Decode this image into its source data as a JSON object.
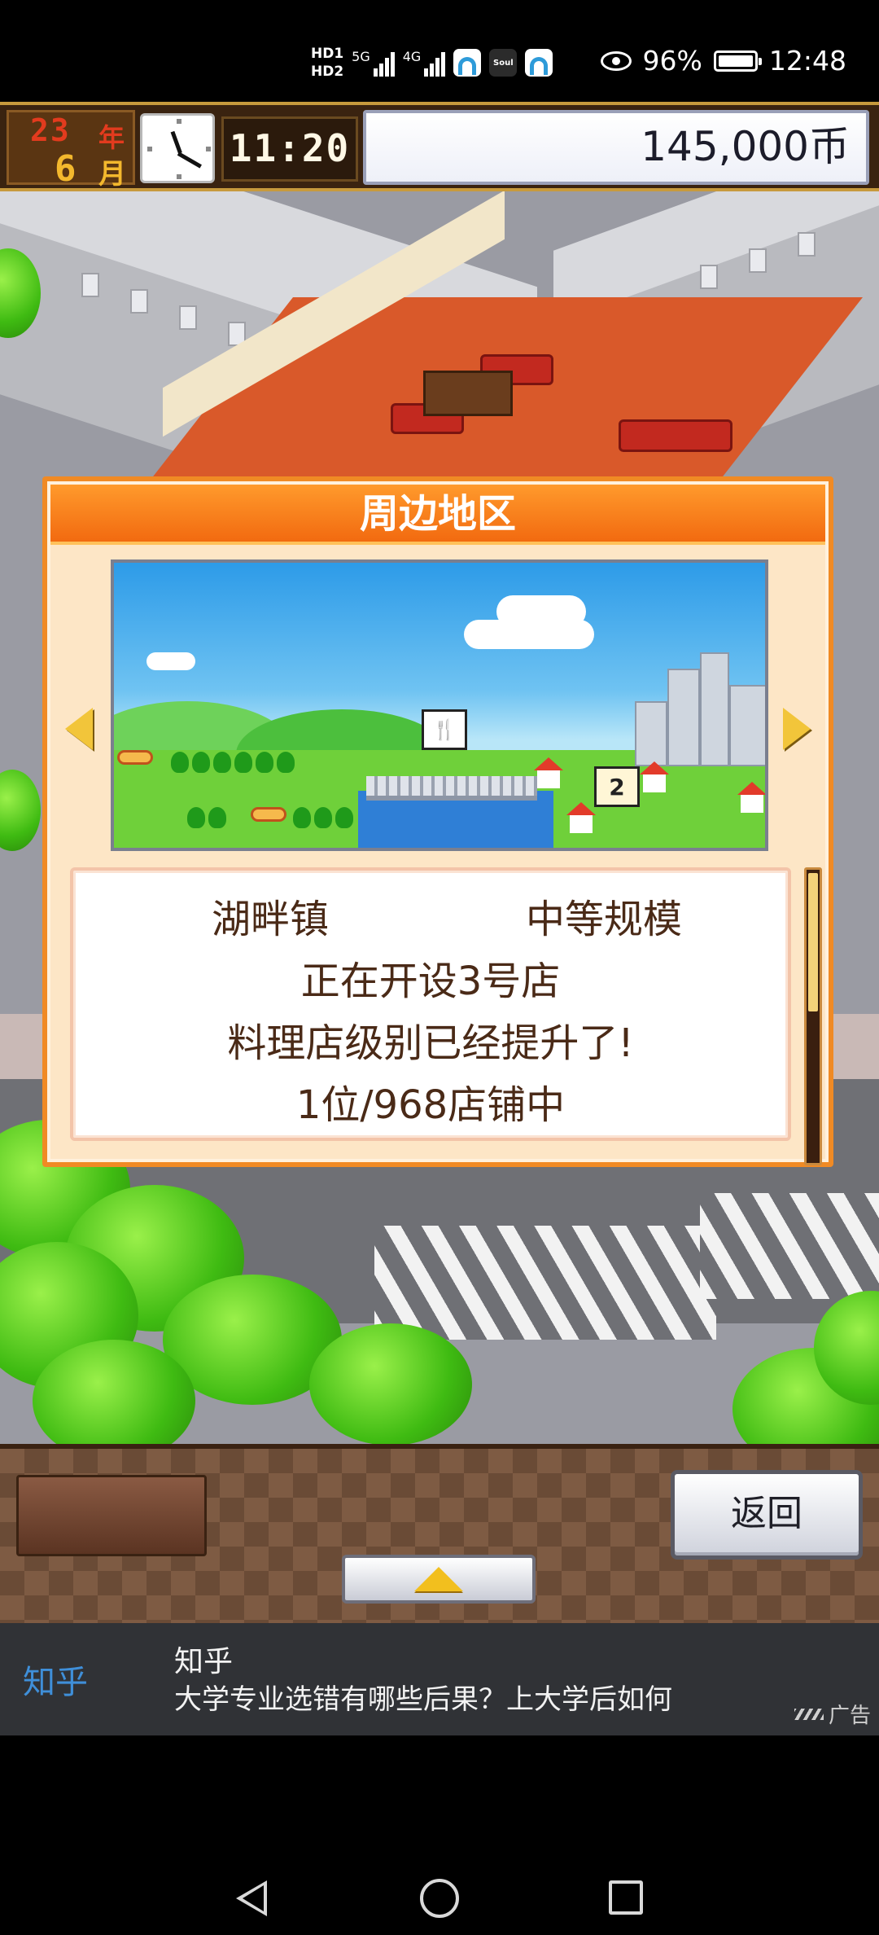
{
  "status_bar": {
    "hd1": "HD1",
    "hd2": "HD2",
    "signal1_label": "5G",
    "signal2_label": "4G",
    "app_icon_label": "Soul",
    "battery": "96%",
    "time": "12:48"
  },
  "hud": {
    "year_value": "23",
    "year_unit": "年",
    "month_value": "6",
    "month_unit": "月",
    "game_time": "11:20",
    "money": "145,000币"
  },
  "dialog": {
    "title": "周边地区",
    "town_name": "湖畔镇",
    "scale": "中等规模",
    "line2": "正在开设3号店",
    "line3": "料理店级别已经提升了!",
    "line4": "1位/968店铺中",
    "shop_marker": "2"
  },
  "bottom_panel": {
    "back_label": "返回"
  },
  "ad": {
    "brand": "知乎",
    "title": "知乎",
    "text": "大学专业选错有哪些后果？上大学后如何",
    "tag": "广告"
  },
  "colors": {
    "dialog_header": "#f26a10",
    "dialog_bg": "#fde6c6",
    "info_text": "#4a2a17",
    "ad_brand": "#3f8fd9"
  },
  "icons": [
    "eye-icon",
    "battery-icon",
    "clock-icon",
    "arrow-left-icon",
    "arrow-right-icon",
    "up-arrow-icon",
    "nav-back-icon",
    "nav-home-icon",
    "nav-recent-icon"
  ]
}
